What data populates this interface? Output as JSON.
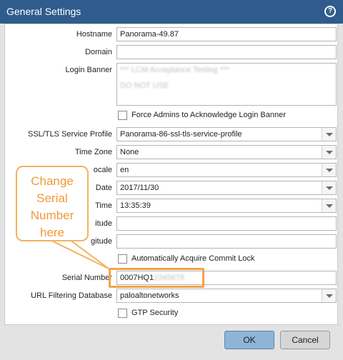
{
  "dialog": {
    "title": "General Settings",
    "help_icon": "help-icon"
  },
  "fields": {
    "hostname": {
      "label": "Hostname",
      "value": "Panorama-49.87"
    },
    "domain": {
      "label": "Domain",
      "value": ""
    },
    "login_banner": {
      "label": "Login Banner",
      "line1": "*** LCM Acceptance Testing ***",
      "line2": "DO NOT USE"
    },
    "force_ack": {
      "label": "Force Admins to Acknowledge Login Banner",
      "checked": false
    },
    "ssl_tls": {
      "label": "SSL/TLS Service Profile",
      "value": "Panorama-86-ssl-tls-service-profile"
    },
    "time_zone": {
      "label": "Time Zone",
      "value": "None"
    },
    "locale": {
      "label": "Locale",
      "label_visible": "ocale",
      "value": "en"
    },
    "date": {
      "label": "Date",
      "value": "2017/11/30"
    },
    "time": {
      "label": "Time",
      "value": "13:35:39"
    },
    "latitude": {
      "label": "Latitude",
      "label_visible": "itude",
      "value": ""
    },
    "longitude": {
      "label": "Longitude",
      "label_visible": "gitude",
      "value": ""
    },
    "auto_commit_lock": {
      "label": "Automatically Acquire Commit Lock",
      "checked": false
    },
    "serial_number": {
      "label": "Serial Number",
      "value": "0007HQ1",
      "value_hidden": "2345678"
    },
    "url_filtering": {
      "label": "URL Filtering Database",
      "value": "paloaltonetworks"
    },
    "gtp_security": {
      "label": "GTP Security",
      "checked": false
    }
  },
  "callout": {
    "line1": "Change",
    "line2": "Serial",
    "line3": "Number",
    "line4": "here",
    "color": "#f09a36"
  },
  "buttons": {
    "ok": "OK",
    "cancel": "Cancel"
  },
  "colors": {
    "titlebar": "#2f5c8c",
    "highlight": "#f3a34b",
    "ok_button": "#8fb4d6"
  }
}
